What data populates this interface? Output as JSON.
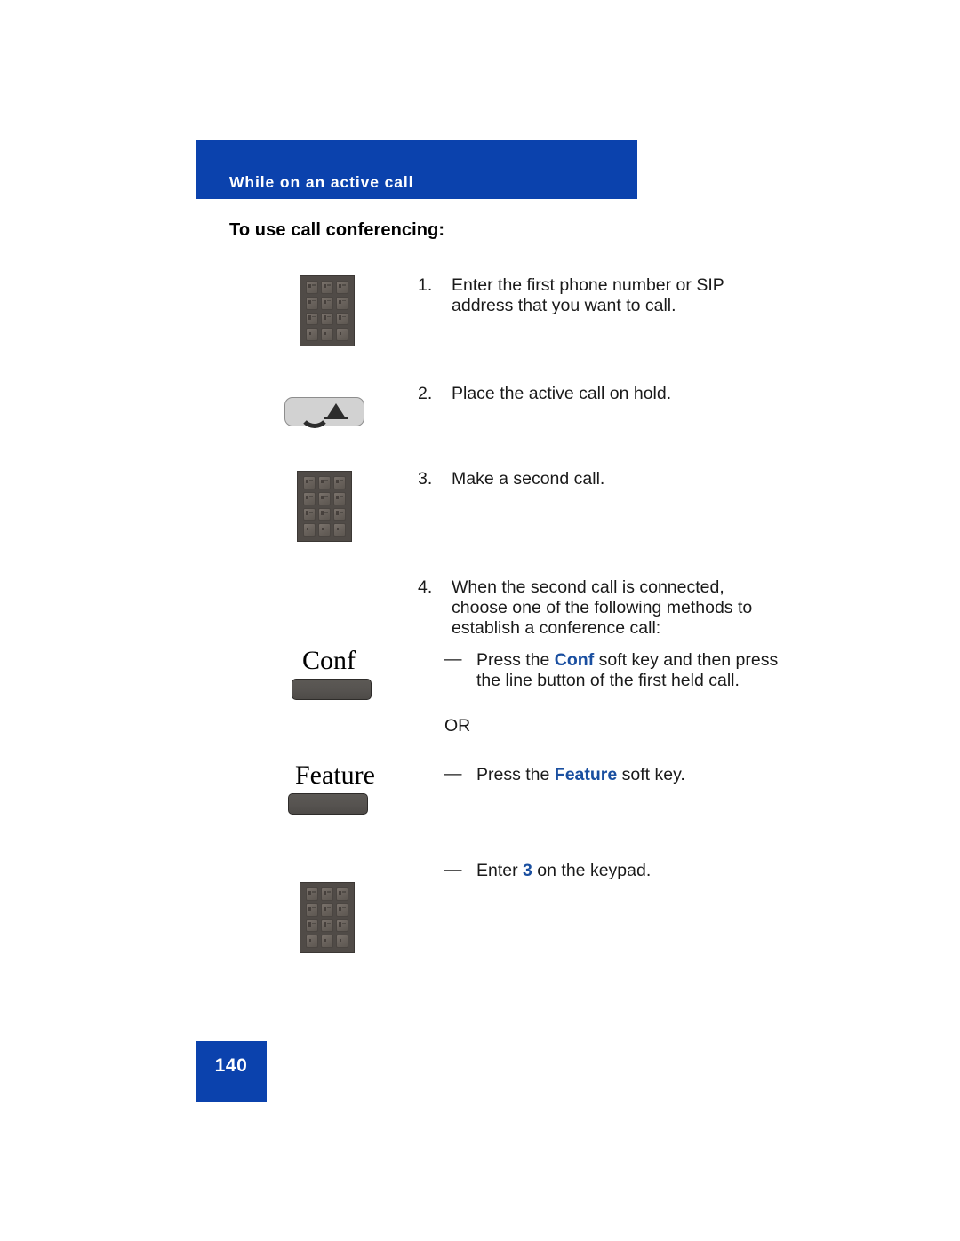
{
  "header": {
    "banner_label": "While on an active call",
    "banner_color": "#0b42ad"
  },
  "section": {
    "heading": "To use call conferencing:"
  },
  "accent": {
    "key_text_color": "#1a4fa0",
    "banner_blue": "#0b42ad"
  },
  "steps": [
    {
      "number": "1.",
      "text": "Enter the first phone number or SIP address that you want to call.",
      "icon": "keypad-icon"
    },
    {
      "number": "2.",
      "text": "Place the active call on hold.",
      "icon": "hold-button-icon"
    },
    {
      "number": "3.",
      "text": "Make a second call.",
      "icon": "keypad-icon"
    },
    {
      "number": "4.",
      "text": "When the second call is connected, choose one of the following methods to establish a conference call:",
      "icon": null
    }
  ],
  "substeps": [
    {
      "dash": "—",
      "prefix": "Press the ",
      "key": "Conf",
      "suffix": " soft key and then press the line button of the first held call.",
      "icon": "conf-soft-key"
    },
    {
      "dash": "—",
      "prefix": "Press the ",
      "key": "Feature",
      "suffix": " soft key.",
      "icon": "feature-soft-key"
    },
    {
      "dash": "—",
      "prefix": "Enter ",
      "key": "3",
      "suffix": " on the keypad.",
      "icon": "keypad-icon"
    }
  ],
  "or_separator": "OR",
  "softkeys": {
    "conf_label": "Conf",
    "feature_label": "Feature"
  },
  "footer": {
    "page_number": "140"
  }
}
